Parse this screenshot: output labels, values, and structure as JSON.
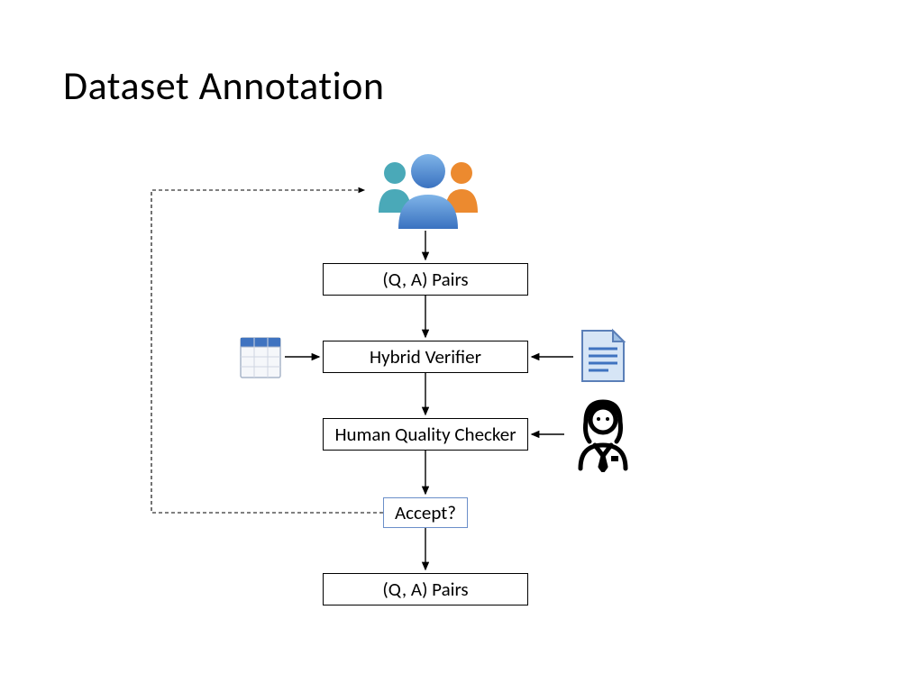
{
  "title": "Dataset Annotation",
  "nodes": {
    "qa_pairs_top": "(Q, A) Pairs",
    "hybrid_verifier": "Hybrid Verifier",
    "human_checker": "Human Quality Checker",
    "accept": "Accept?",
    "qa_pairs_bottom": "(Q, A) Pairs"
  },
  "icons": {
    "crowd": "people-group-icon",
    "table": "spreadsheet-icon",
    "document": "document-icon",
    "reviewer": "reviewer-person-icon"
  }
}
